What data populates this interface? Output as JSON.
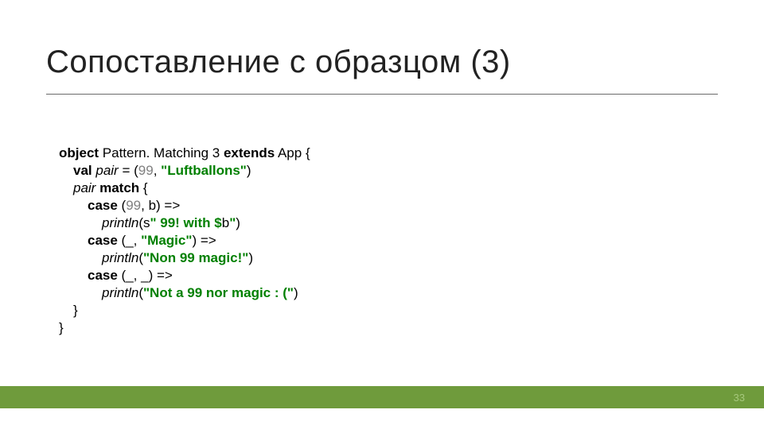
{
  "title": "Сопоставление с образцом (3)",
  "page": "33",
  "code": {
    "l1_kw1": "object",
    "l1_name": " Pattern. Matching 3 ",
    "l1_kw2": "extends",
    "l1_app": " App {",
    "l2_kw": "val",
    "l2_var": " pair",
    "l2_eq": " = (",
    "l2_num": "99",
    "l2_mid": ", ",
    "l2_str": "\"Luftballons\"",
    "l2_end": ")",
    "l3_var": "pair",
    "l3_sp": " ",
    "l3_kw": "match",
    "l3_end": " {",
    "l4_kw": "case",
    "l4_open": " (",
    "l4_num": "99",
    "l4_rest": ", b) =>",
    "l5_fn": "println",
    "l5_open": "(",
    "l5_s": "s",
    "l5_str1": "\" 99! with $",
    "l5_var": "b",
    "l5_str2": "\"",
    "l5_close": ")",
    "l6_kw": "case",
    "l6_open": " (_, ",
    "l6_str": "\"Magic\"",
    "l6_end": ") =>",
    "l7_fn": "println",
    "l7_open": "(",
    "l7_str": "\"Non 99 magic!\"",
    "l7_close": ")",
    "l8_kw": "case",
    "l8_rest": " (_, _) =>",
    "l9_fn": "println",
    "l9_open": "(",
    "l9_str": "\"Not a 99 nor magic : (\"",
    "l9_close": ")",
    "l10": "}",
    "l11": "}"
  }
}
